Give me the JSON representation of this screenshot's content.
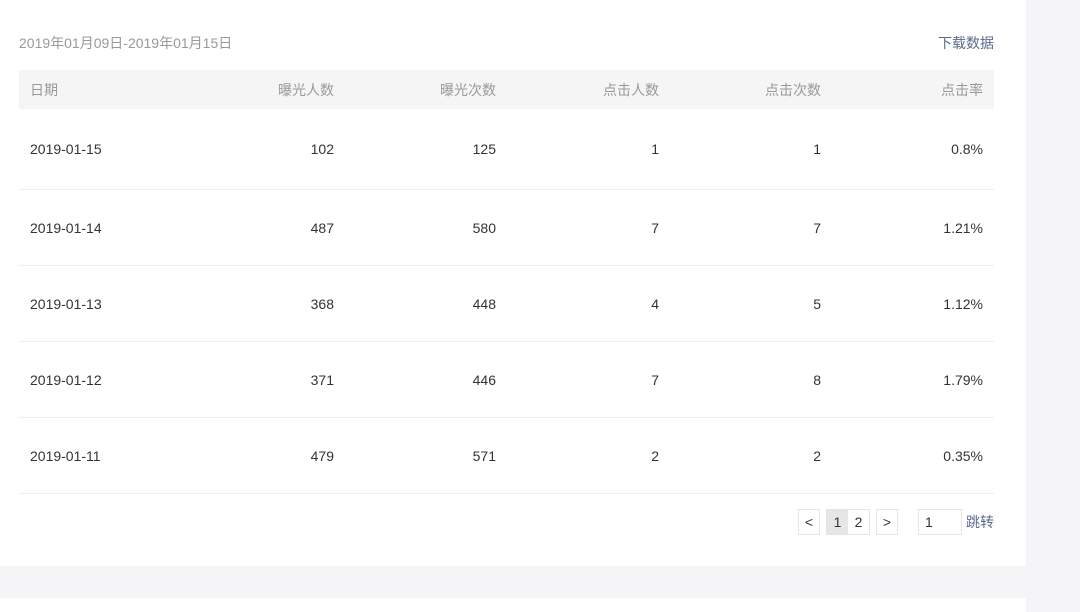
{
  "header": {
    "date_range": "2019年01月09日-2019年01月15日",
    "download_label": "下载数据"
  },
  "table": {
    "columns": [
      "日期",
      "曝光人数",
      "曝光次数",
      "点击人数",
      "点击次数",
      "点击率"
    ],
    "rows": [
      [
        "2019-01-15",
        "102",
        "125",
        "1",
        "1",
        "0.8%"
      ],
      [
        "2019-01-14",
        "487",
        "580",
        "7",
        "7",
        "1.21%"
      ],
      [
        "2019-01-13",
        "368",
        "448",
        "4",
        "5",
        "1.12%"
      ],
      [
        "2019-01-12",
        "371",
        "446",
        "7",
        "8",
        "1.79%"
      ],
      [
        "2019-01-11",
        "479",
        "571",
        "2",
        "2",
        "0.35%"
      ]
    ]
  },
  "pagination": {
    "prev_label": "<",
    "next_label": ">",
    "pages": [
      "1",
      "2"
    ],
    "current_page": "1",
    "jump_value": "1",
    "jump_label": "跳转"
  }
}
